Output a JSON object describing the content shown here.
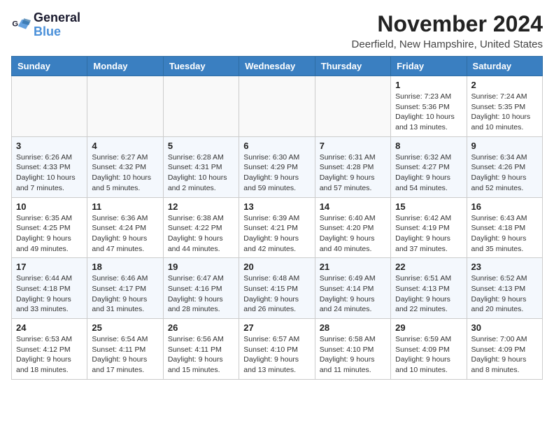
{
  "logo": {
    "text_general": "General",
    "text_blue": "Blue"
  },
  "header": {
    "month": "November 2024",
    "location": "Deerfield, New Hampshire, United States"
  },
  "weekdays": [
    "Sunday",
    "Monday",
    "Tuesday",
    "Wednesday",
    "Thursday",
    "Friday",
    "Saturday"
  ],
  "weeks": [
    [
      {
        "day": "",
        "info": ""
      },
      {
        "day": "",
        "info": ""
      },
      {
        "day": "",
        "info": ""
      },
      {
        "day": "",
        "info": ""
      },
      {
        "day": "",
        "info": ""
      },
      {
        "day": "1",
        "info": "Sunrise: 7:23 AM\nSunset: 5:36 PM\nDaylight: 10 hours and 13 minutes."
      },
      {
        "day": "2",
        "info": "Sunrise: 7:24 AM\nSunset: 5:35 PM\nDaylight: 10 hours and 10 minutes."
      }
    ],
    [
      {
        "day": "3",
        "info": "Sunrise: 6:26 AM\nSunset: 4:33 PM\nDaylight: 10 hours and 7 minutes."
      },
      {
        "day": "4",
        "info": "Sunrise: 6:27 AM\nSunset: 4:32 PM\nDaylight: 10 hours and 5 minutes."
      },
      {
        "day": "5",
        "info": "Sunrise: 6:28 AM\nSunset: 4:31 PM\nDaylight: 10 hours and 2 minutes."
      },
      {
        "day": "6",
        "info": "Sunrise: 6:30 AM\nSunset: 4:29 PM\nDaylight: 9 hours and 59 minutes."
      },
      {
        "day": "7",
        "info": "Sunrise: 6:31 AM\nSunset: 4:28 PM\nDaylight: 9 hours and 57 minutes."
      },
      {
        "day": "8",
        "info": "Sunrise: 6:32 AM\nSunset: 4:27 PM\nDaylight: 9 hours and 54 minutes."
      },
      {
        "day": "9",
        "info": "Sunrise: 6:34 AM\nSunset: 4:26 PM\nDaylight: 9 hours and 52 minutes."
      }
    ],
    [
      {
        "day": "10",
        "info": "Sunrise: 6:35 AM\nSunset: 4:25 PM\nDaylight: 9 hours and 49 minutes."
      },
      {
        "day": "11",
        "info": "Sunrise: 6:36 AM\nSunset: 4:24 PM\nDaylight: 9 hours and 47 minutes."
      },
      {
        "day": "12",
        "info": "Sunrise: 6:38 AM\nSunset: 4:22 PM\nDaylight: 9 hours and 44 minutes."
      },
      {
        "day": "13",
        "info": "Sunrise: 6:39 AM\nSunset: 4:21 PM\nDaylight: 9 hours and 42 minutes."
      },
      {
        "day": "14",
        "info": "Sunrise: 6:40 AM\nSunset: 4:20 PM\nDaylight: 9 hours and 40 minutes."
      },
      {
        "day": "15",
        "info": "Sunrise: 6:42 AM\nSunset: 4:19 PM\nDaylight: 9 hours and 37 minutes."
      },
      {
        "day": "16",
        "info": "Sunrise: 6:43 AM\nSunset: 4:18 PM\nDaylight: 9 hours and 35 minutes."
      }
    ],
    [
      {
        "day": "17",
        "info": "Sunrise: 6:44 AM\nSunset: 4:18 PM\nDaylight: 9 hours and 33 minutes."
      },
      {
        "day": "18",
        "info": "Sunrise: 6:46 AM\nSunset: 4:17 PM\nDaylight: 9 hours and 31 minutes."
      },
      {
        "day": "19",
        "info": "Sunrise: 6:47 AM\nSunset: 4:16 PM\nDaylight: 9 hours and 28 minutes."
      },
      {
        "day": "20",
        "info": "Sunrise: 6:48 AM\nSunset: 4:15 PM\nDaylight: 9 hours and 26 minutes."
      },
      {
        "day": "21",
        "info": "Sunrise: 6:49 AM\nSunset: 4:14 PM\nDaylight: 9 hours and 24 minutes."
      },
      {
        "day": "22",
        "info": "Sunrise: 6:51 AM\nSunset: 4:13 PM\nDaylight: 9 hours and 22 minutes."
      },
      {
        "day": "23",
        "info": "Sunrise: 6:52 AM\nSunset: 4:13 PM\nDaylight: 9 hours and 20 minutes."
      }
    ],
    [
      {
        "day": "24",
        "info": "Sunrise: 6:53 AM\nSunset: 4:12 PM\nDaylight: 9 hours and 18 minutes."
      },
      {
        "day": "25",
        "info": "Sunrise: 6:54 AM\nSunset: 4:11 PM\nDaylight: 9 hours and 17 minutes."
      },
      {
        "day": "26",
        "info": "Sunrise: 6:56 AM\nSunset: 4:11 PM\nDaylight: 9 hours and 15 minutes."
      },
      {
        "day": "27",
        "info": "Sunrise: 6:57 AM\nSunset: 4:10 PM\nDaylight: 9 hours and 13 minutes."
      },
      {
        "day": "28",
        "info": "Sunrise: 6:58 AM\nSunset: 4:10 PM\nDaylight: 9 hours and 11 minutes."
      },
      {
        "day": "29",
        "info": "Sunrise: 6:59 AM\nSunset: 4:09 PM\nDaylight: 9 hours and 10 minutes."
      },
      {
        "day": "30",
        "info": "Sunrise: 7:00 AM\nSunset: 4:09 PM\nDaylight: 9 hours and 8 minutes."
      }
    ]
  ]
}
